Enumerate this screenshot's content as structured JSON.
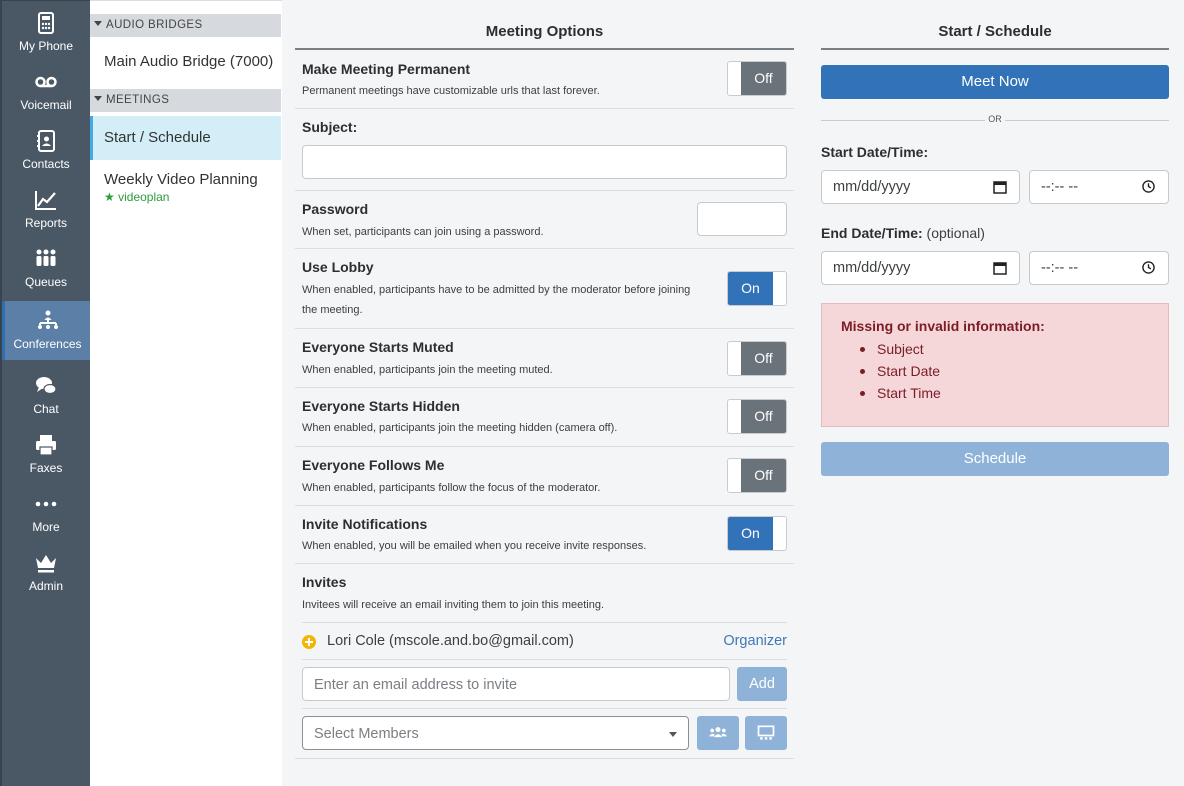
{
  "nav": [
    {
      "label": "My Phone",
      "icon": "phone-icon"
    },
    {
      "label": "Voicemail",
      "icon": "voicemail-icon"
    },
    {
      "label": "Contacts",
      "icon": "contacts-icon"
    },
    {
      "label": "Reports",
      "icon": "chart-line-icon"
    },
    {
      "label": "Queues",
      "icon": "queue-icon"
    },
    {
      "label": "Conferences",
      "icon": "conference-icon"
    },
    {
      "label": "Chat",
      "icon": "chat-icon"
    },
    {
      "label": "Faxes",
      "icon": "fax-icon"
    },
    {
      "label": "More",
      "icon": "more-dots-icon"
    },
    {
      "label": "Admin",
      "icon": "crown-icon"
    }
  ],
  "panel": {
    "audio_header": "AUDIO BRIDGES",
    "audio_item": "Main Audio Bridge (7000)",
    "meetings_header": "MEETINGS",
    "start_item": "Start / Schedule",
    "weekly_item": "Weekly Video Planning",
    "weekly_sub": "videoplan"
  },
  "options": {
    "heading": "Meeting Options",
    "permanent": {
      "title": "Make Meeting Permanent",
      "desc": "Permanent meetings have customizable urls that last forever.",
      "state": "Off"
    },
    "subject": {
      "title": "Subject:",
      "value": ""
    },
    "password": {
      "title": "Password",
      "desc": "When set, participants can join using a password.",
      "value": ""
    },
    "lobby": {
      "title": "Use Lobby",
      "desc": "When enabled, participants have to be admitted by the moderator before joining the meeting.",
      "state": "On"
    },
    "muted": {
      "title": "Everyone Starts Muted",
      "desc": "When enabled, participants join the meeting muted.",
      "state": "Off"
    },
    "hidden": {
      "title": "Everyone Starts Hidden",
      "desc": "When enabled, participants join the meeting hidden (camera off).",
      "state": "Off"
    },
    "follows": {
      "title": "Everyone Follows Me",
      "desc": "When enabled, participants follow the focus of the moderator.",
      "state": "Off"
    },
    "notify": {
      "title": "Invite Notifications",
      "desc": "When enabled, you will be emailed when you receive invite responses.",
      "state": "On"
    },
    "invites": {
      "title": "Invites",
      "desc": "Invitees will receive an email inviting them to join this meeting."
    },
    "invitee": {
      "name": "Lori Cole (mscole.and.bo@gmail.com)",
      "role": "Organizer"
    },
    "email_placeholder": "Enter an email address to invite",
    "add_label": "Add",
    "members_placeholder": "Select Members"
  },
  "schedule": {
    "heading": "Start / Schedule",
    "meet_now": "Meet Now",
    "or": "OR",
    "start_label": "Start Date/Time:",
    "end_label": "End Date/Time:",
    "end_optional": "(optional)",
    "date_placeholder": "mm/dd/yyyy",
    "time_placeholder": "--:-- --",
    "error_title": "Missing or invalid information:",
    "errors": [
      "Subject",
      "Start Date",
      "Start Time"
    ],
    "schedule_label": "Schedule"
  },
  "colors": {
    "primary": "#3272b8",
    "toggle_off": "#6b737a",
    "alert_bg": "#f5d6d9",
    "nav_bg": "#4a5866",
    "success": "#2e9b3e"
  }
}
